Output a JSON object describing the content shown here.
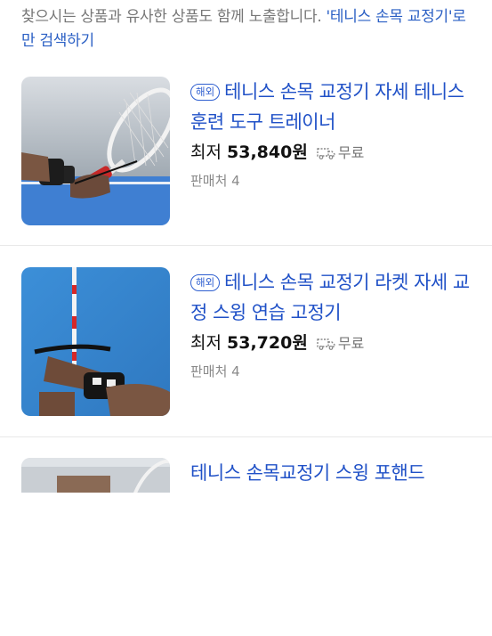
{
  "notice": {
    "prefix": "찾으시는 상품과 유사한 상품도 함께 노출합니다. ",
    "query": "'테니스 손목 교정기'",
    "suffix": "로만 검색하기"
  },
  "items": [
    {
      "badge": "해외",
      "title": "테니스 손목 교정기 자세 테니스훈련 도구 트레이너",
      "price_label": "최저",
      "price": "53,840원",
      "shipping": "무료",
      "seller_count": "판매처 4"
    },
    {
      "badge": "해외",
      "title": "테니스 손목 교정기 라켓 자세 교정 스윙 연습 고정기",
      "price_label": "최저",
      "price": "53,720원",
      "shipping": "무료",
      "seller_count": "판매처 4"
    },
    {
      "title": "테니스 손목교정기 스윙 포핸드"
    }
  ],
  "colors": {
    "link": "#2051c7",
    "badge": "#2f5fd0",
    "muted": "#777777"
  }
}
